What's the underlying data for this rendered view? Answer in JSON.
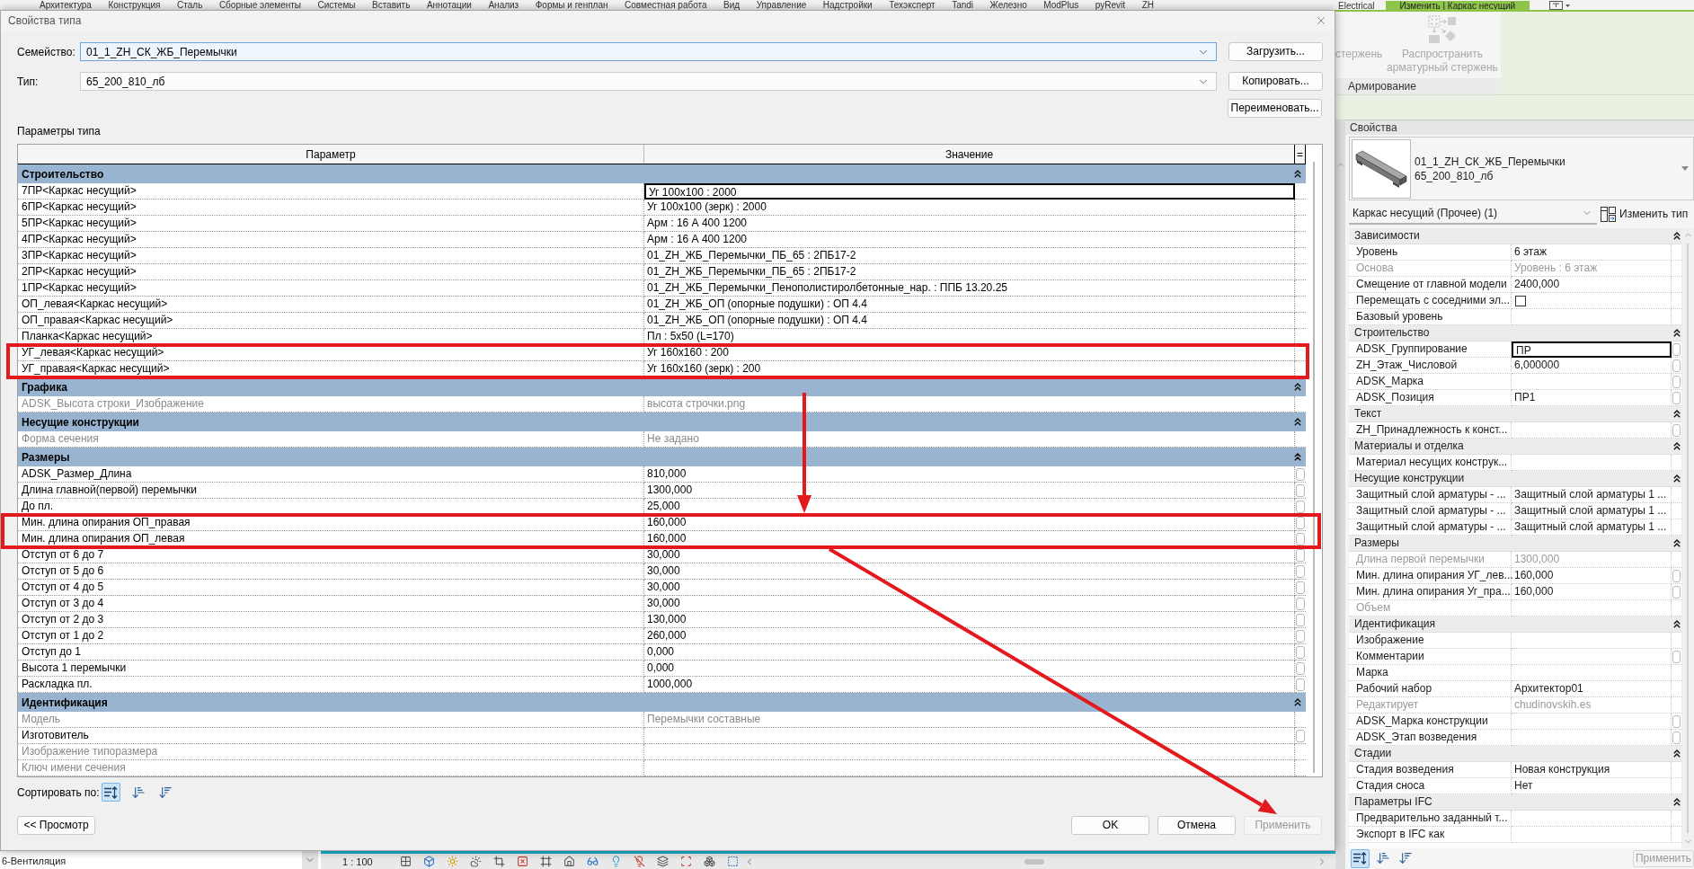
{
  "ribbon": {
    "tabs": [
      {
        "label": "Архитектура",
        "selected": false
      },
      {
        "label": "Конструкция",
        "selected": false
      },
      {
        "label": "Сталь",
        "selected": false
      },
      {
        "label": "Сборные элементы",
        "selected": false
      },
      {
        "label": "Системы",
        "selected": false
      },
      {
        "label": "Вставить",
        "selected": false
      },
      {
        "label": "Аннотации",
        "selected": false
      },
      {
        "label": "Анализ",
        "selected": false
      },
      {
        "label": "Формы и генплан",
        "selected": false
      },
      {
        "label": "Совместная работа",
        "selected": false
      },
      {
        "label": "Вид",
        "selected": false
      },
      {
        "label": "Управление",
        "selected": false
      },
      {
        "label": "Надстройки",
        "selected": false
      },
      {
        "label": "Техэксперт",
        "selected": false
      },
      {
        "label": "Tandi",
        "selected": false
      },
      {
        "label": "Железно",
        "selected": false
      },
      {
        "label": "ModPlus",
        "selected": false
      },
      {
        "label": "pyRevit",
        "selected": false
      },
      {
        "label": "ZH",
        "selected": false
      },
      {
        "label": "Electrical",
        "selected": false
      },
      {
        "label": "Изменить | Каркас несущий",
        "selected": true
      }
    ],
    "panel": {
      "buttons": [
        {
          "label": "стержень",
          "disabled": true
        },
        {
          "label": "Распространить арматурный стержень",
          "disabled": true
        }
      ],
      "title": "Армирование"
    }
  },
  "dialog": {
    "title": "Свойства типа",
    "family": {
      "label": "Семейство:",
      "value": "01_1_ZH_СК_ЖБ_Перемычки",
      "focused": true
    },
    "type": {
      "label": "Тип:",
      "value": "65_200_810_лб",
      "focused": false
    },
    "side_buttons": [
      "Загрузить...",
      "Копировать...",
      "Переименовать..."
    ],
    "params_label": "Параметры типа",
    "table": {
      "columns": [
        "Параметр",
        "Значение",
        "="
      ],
      "groups": [
        {
          "name": "Строительство",
          "expanded": true,
          "rows": [
            {
              "name": "7ПР<Каркас несущий>",
              "value": "Уг 100x100 : 2000",
              "disabled": false,
              "selected": true,
              "link_button": false
            },
            {
              "name": "6ПР<Каркас несущий>",
              "value": "Уг 100x100 (зерк) : 2000",
              "disabled": false,
              "selected": false,
              "link_button": false
            },
            {
              "name": "5ПР<Каркас несущий>",
              "value": "Арм : 16 А 400 1200",
              "disabled": false,
              "selected": false,
              "link_button": false
            },
            {
              "name": "4ПР<Каркас несущий>",
              "value": "Арм : 16 А 400 1200",
              "disabled": false,
              "selected": false,
              "link_button": false
            },
            {
              "name": "3ПР<Каркас несущий>",
              "value": "01_ZH_ЖБ_Перемычки_ПБ_65 : 2ПБ17-2",
              "disabled": false,
              "selected": false,
              "link_button": false
            },
            {
              "name": "2ПР<Каркас несущий>",
              "value": "01_ZH_ЖБ_Перемычки_ПБ_65 : 2ПБ17-2",
              "disabled": false,
              "selected": false,
              "link_button": false
            },
            {
              "name": "1ПР<Каркас несущий>",
              "value": "01_ZH_ЖБ_Перемычки_Пенополистиролбетонные_нар. : ППБ 13.20.25",
              "disabled": false,
              "selected": false,
              "link_button": false
            },
            {
              "name": "ОП_левая<Каркас несущий>",
              "value": "01_ZH_ЖБ_ОП (опорные подушки) : ОП 4.4",
              "disabled": false,
              "selected": false,
              "link_button": false
            },
            {
              "name": "ОП_правая<Каркас несущий>",
              "value": "01_ZH_ЖБ_ОП (опорные подушки) : ОП 4.4",
              "disabled": false,
              "selected": false,
              "link_button": false
            },
            {
              "name": "Планка<Каркас несущий>",
              "value": "Пл : 5x50 (L=170)",
              "disabled": false,
              "selected": false,
              "link_button": false
            },
            {
              "name": "УГ_левая<Каркас несущий>",
              "value": "Уг 160x160 : 200",
              "disabled": false,
              "selected": false,
              "link_button": false
            },
            {
              "name": "УГ_правая<Каркас несущий>",
              "value": "Уг 160x160 (зерк) : 200",
              "disabled": false,
              "selected": false,
              "link_button": false
            }
          ]
        },
        {
          "name": "Графика",
          "expanded": true,
          "rows": [
            {
              "name": "ADSK_Высота строки_Изображение",
              "value": "высота строчки.png",
              "disabled": true,
              "selected": false,
              "link_button": false
            }
          ]
        },
        {
          "name": "Несущие конструкции",
          "expanded": true,
          "rows": [
            {
              "name": "Форма сечения",
              "value": "Не задано",
              "disabled": true,
              "selected": false,
              "link_button": false
            }
          ]
        },
        {
          "name": "Размеры",
          "expanded": true,
          "rows": [
            {
              "name": "ADSK_Размер_Длина",
              "value": "810,000",
              "disabled": false,
              "selected": false,
              "link_button": true
            },
            {
              "name": "Длина главной(первой) перемычки",
              "value": "1300,000",
              "disabled": false,
              "selected": false,
              "link_button": true
            },
            {
              "name": "До пл.",
              "value": "25,000",
              "disabled": false,
              "selected": false,
              "link_button": true
            },
            {
              "name": "Мин. длина опирания ОП_правая",
              "value": "160,000",
              "disabled": false,
              "selected": false,
              "link_button": true
            },
            {
              "name": "Мин. длина опирания ОП_левая",
              "value": "160,000",
              "disabled": false,
              "selected": false,
              "link_button": true
            },
            {
              "name": "Отступ от 6 до 7",
              "value": "30,000",
              "disabled": false,
              "selected": false,
              "link_button": true
            },
            {
              "name": "Отступ от 5 до 6",
              "value": "30,000",
              "disabled": false,
              "selected": false,
              "link_button": true
            },
            {
              "name": "Отступ от 4 до 5",
              "value": "30,000",
              "disabled": false,
              "selected": false,
              "link_button": true
            },
            {
              "name": "Отступ от 3 до 4",
              "value": "30,000",
              "disabled": false,
              "selected": false,
              "link_button": true
            },
            {
              "name": "Отступ от 2 до 3",
              "value": "130,000",
              "disabled": false,
              "selected": false,
              "link_button": true
            },
            {
              "name": "Отступ от 1 до 2",
              "value": "260,000",
              "disabled": false,
              "selected": false,
              "link_button": true
            },
            {
              "name": "Отступ до 1",
              "value": "0,000",
              "disabled": false,
              "selected": false,
              "link_button": true
            },
            {
              "name": "Высота 1 перемычки",
              "value": "0,000",
              "disabled": false,
              "selected": false,
              "link_button": true
            },
            {
              "name": "Раскладка пл.",
              "value": "1000,000",
              "disabled": false,
              "selected": false,
              "link_button": true
            }
          ]
        },
        {
          "name": "Идентификация",
          "expanded": true,
          "rows": [
            {
              "name": "Модель",
              "value": "Перемычки составные",
              "disabled": true,
              "selected": false,
              "link_button": false
            },
            {
              "name": "Изготовитель",
              "disabled": false,
              "selected": false,
              "link_button": true
            },
            {
              "name": "Изображение типоразмера",
              "disabled": true,
              "selected": false,
              "link_button": false
            },
            {
              "name": "Ключ имени сечения",
              "disabled": true,
              "selected": false,
              "link_button": false
            }
          ]
        }
      ]
    },
    "sort": {
      "label": "Сортировать по:",
      "buttons": [
        {
          "kind": "grouped",
          "selected": true
        },
        {
          "kind": "ascending",
          "selected": false
        },
        {
          "kind": "descending",
          "selected": false
        }
      ]
    },
    "preview_button": "<< Просмотр",
    "buttons": [
      {
        "label": "OK",
        "disabled": false
      },
      {
        "label": "Отмена",
        "disabled": false
      },
      {
        "label": "Применить",
        "disabled": true
      }
    ]
  },
  "annotations": [
    {
      "kind": "box"
    },
    {
      "kind": "box"
    },
    {
      "kind": "arrow"
    },
    {
      "kind": "arrow"
    }
  ],
  "project_browser": {
    "items": [
      "6-Вентиляция"
    ]
  },
  "view_control_bar": {
    "scale": "1 : 100"
  },
  "properties": {
    "title": "Свойства",
    "type_selector": {
      "family": "01_1_ZH_СК_ЖБ_Перемычки",
      "type": "65_200_810_лб"
    },
    "instance_filter": "Каркас несущий (Прочее) (1)",
    "edit_type_button": "Изменить тип",
    "groups": [
      {
        "name": "Зависимости",
        "expanded": true,
        "rows": [
          {
            "kind": "text",
            "name": "Уровень",
            "value": "6 этаж",
            "disabled": false,
            "selected": false,
            "link_button": false
          },
          {
            "kind": "text",
            "name": "Основа",
            "value": "Уровень : 6 этаж",
            "disabled": true,
            "selected": false,
            "link_button": false
          },
          {
            "kind": "text",
            "name": "Смещение от главной модели",
            "value": "2400,000",
            "disabled": false,
            "selected": false,
            "link_button": false
          },
          {
            "kind": "checkbox",
            "name": "Перемещать с соседними эл...",
            "checked": false,
            "disabled": false,
            "selected": false,
            "link_button": false
          },
          {
            "kind": "text",
            "name": "Базовый уровень",
            "disabled": false,
            "selected": false,
            "link_button": false
          }
        ]
      },
      {
        "name": "Строительство",
        "expanded": true,
        "rows": [
          {
            "kind": "text",
            "name": "ADSK_Группирование",
            "value": "ПР",
            "disabled": false,
            "selected": true,
            "link_button": true
          },
          {
            "kind": "text",
            "name": "ZH_Этаж_Числовой",
            "value": "6,000000",
            "disabled": false,
            "selected": false,
            "link_button": true
          },
          {
            "kind": "text",
            "name": "ADSK_Марка",
            "disabled": false,
            "selected": false,
            "link_button": true
          },
          {
            "kind": "text",
            "name": "ADSK_Позиция",
            "value": "ПР1",
            "disabled": false,
            "selected": false,
            "link_button": true
          }
        ]
      },
      {
        "name": "Текст",
        "expanded": true,
        "rows": [
          {
            "kind": "text",
            "name": "ZH_Принадлежность к конст...",
            "disabled": false,
            "selected": false,
            "link_button": true
          }
        ]
      },
      {
        "name": "Материалы и отделка",
        "expanded": true,
        "rows": [
          {
            "kind": "text",
            "name": "Материал несущих конструк...",
            "disabled": false,
            "selected": false,
            "link_button": false
          }
        ]
      },
      {
        "name": "Несущие конструкции",
        "expanded": true,
        "rows": [
          {
            "kind": "text",
            "name": "Защитный слой арматуры - ...",
            "value": "Защитный слой арматуры 1 ...",
            "disabled": false,
            "selected": false,
            "link_button": false
          },
          {
            "kind": "text",
            "name": "Защитный слой арматуры - ...",
            "value": "Защитный слой арматуры 1 ...",
            "disabled": false,
            "selected": false,
            "link_button": false
          },
          {
            "kind": "text",
            "name": "Защитный слой арматуры - ...",
            "value": "Защитный слой арматуры 1 ...",
            "disabled": false,
            "selected": false,
            "link_button": false
          }
        ]
      },
      {
        "name": "Размеры",
        "expanded": true,
        "rows": [
          {
            "kind": "text",
            "name": "Длина первой перемычки",
            "value": "1300,000",
            "disabled": true,
            "selected": false,
            "link_button": false
          },
          {
            "kind": "text",
            "name": "Мин. длина опирания УГ_лев...",
            "value": "160,000",
            "disabled": false,
            "selected": false,
            "link_button": true
          },
          {
            "kind": "text",
            "name": "Мин. длина опирания Уг_пра...",
            "value": "160,000",
            "disabled": false,
            "selected": false,
            "link_button": true
          },
          {
            "kind": "text",
            "name": "Объем",
            "disabled": true,
            "selected": false,
            "link_button": false
          }
        ]
      },
      {
        "name": "Идентификация",
        "expanded": true,
        "rows": [
          {
            "kind": "text",
            "name": "Изображение",
            "disabled": false,
            "selected": false,
            "link_button": false
          },
          {
            "kind": "text",
            "name": "Комментарии",
            "disabled": false,
            "selected": false,
            "link_button": true
          },
          {
            "kind": "text",
            "name": "Марка",
            "disabled": false,
            "selected": false,
            "link_button": false
          },
          {
            "kind": "text",
            "name": "Рабочий набор",
            "value": "Архитектор01",
            "disabled": false,
            "selected": false,
            "link_button": false
          },
          {
            "kind": "text",
            "name": "Редактирует",
            "value": "chudinovskih.es",
            "disabled": true,
            "selected": false,
            "link_button": false
          },
          {
            "kind": "text",
            "name": "ADSK_Марка конструкции",
            "disabled": false,
            "selected": false,
            "link_button": true
          },
          {
            "kind": "text",
            "name": "ADSK_Этап возведения",
            "disabled": false,
            "selected": false,
            "link_button": true
          }
        ]
      },
      {
        "name": "Стадии",
        "expanded": true,
        "rows": [
          {
            "kind": "text",
            "name": "Стадия возведения",
            "value": "Новая конструкция",
            "disabled": false,
            "selected": false,
            "link_button": false
          },
          {
            "kind": "text",
            "name": "Стадия сноса",
            "value": "Нет",
            "disabled": false,
            "selected": false,
            "link_button": false
          }
        ]
      },
      {
        "name": "Параметры IFC",
        "expanded": true,
        "rows": [
          {
            "kind": "text",
            "name": "Предварительно заданный т...",
            "disabled": false,
            "selected": false,
            "link_button": false
          },
          {
            "kind": "text",
            "name": "Экспорт в IFC как",
            "disabled": false,
            "selected": false,
            "link_button": false
          }
        ]
      }
    ],
    "sort_buttons": [
      {
        "kind": "grouped",
        "selected": true
      },
      {
        "kind": "ascending",
        "selected": false
      },
      {
        "kind": "descending",
        "selected": false
      }
    ],
    "apply_button": {
      "label": "Применить",
      "disabled": true
    }
  }
}
